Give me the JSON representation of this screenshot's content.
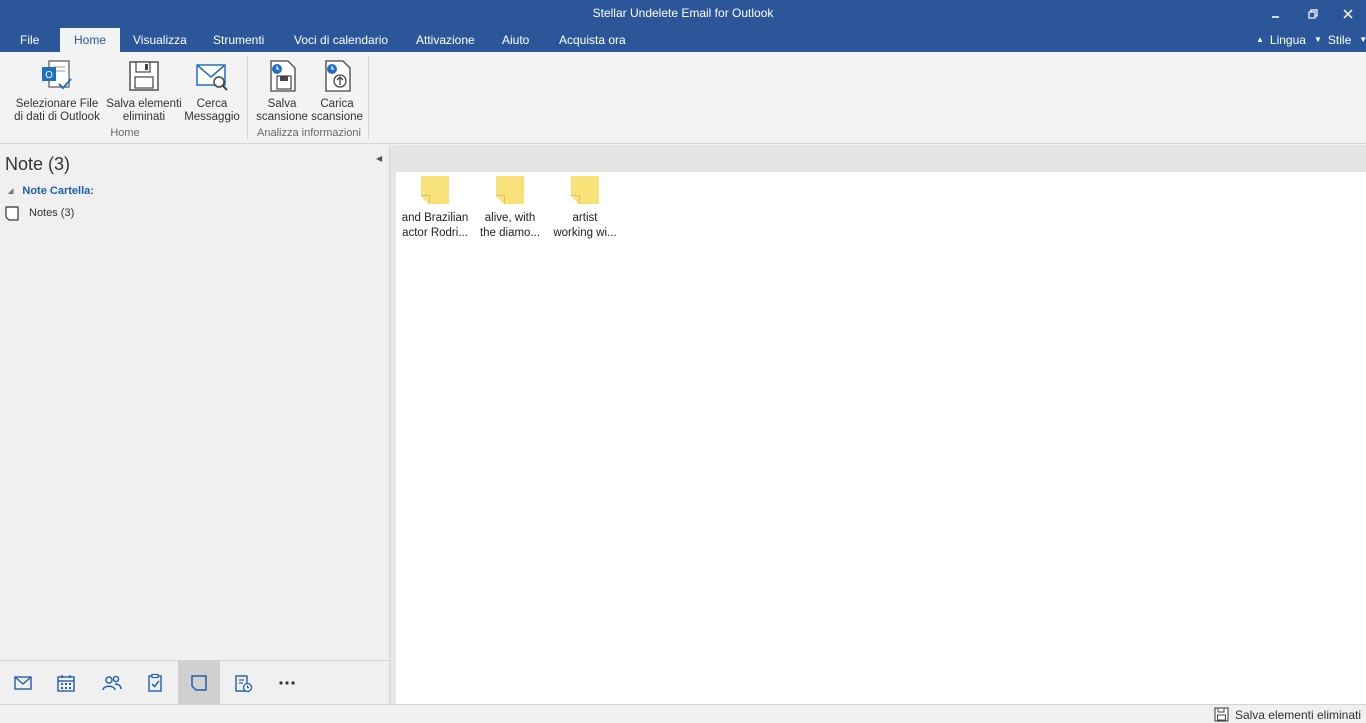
{
  "window": {
    "title": "Stellar Undelete Email for Outlook",
    "minimize_icon": "minimize-icon",
    "restore_icon": "restore-icon",
    "close_icon": "close-icon"
  },
  "menu": {
    "tabs": [
      "File",
      "Home",
      "Visualizza",
      "Strumenti",
      "Voci di calendario",
      "Attivazione",
      "Aiuto",
      "Acquista ora"
    ],
    "active_tab": "Home",
    "language": "Lingua",
    "style": "Stile"
  },
  "ribbon": {
    "groups": [
      {
        "label": "Home",
        "buttons": [
          {
            "line1": "Selezionare File",
            "line2": "di dati di Outlook",
            "icon": "outlook-file-icon"
          },
          {
            "line1": "Salva elementi",
            "line2": "eliminati",
            "icon": "floppy-save-icon"
          },
          {
            "line1": "Cerca",
            "line2": "Messaggio",
            "icon": "mail-search-icon"
          }
        ]
      },
      {
        "label": "Analizza informazioni",
        "buttons": [
          {
            "line1": "Salva",
            "line2": "scansione",
            "icon": "save-scan-icon"
          },
          {
            "line1": "Carica",
            "line2": "scansione",
            "icon": "load-scan-icon"
          }
        ]
      }
    ]
  },
  "left_panel": {
    "title": "Note (3)",
    "tree_header": "Note Cartella:",
    "tree_items": [
      {
        "label": "Notes (3)",
        "icon": "note-icon"
      }
    ],
    "bottom_nav": [
      {
        "icon": "mail-icon",
        "active": false
      },
      {
        "icon": "calendar-icon",
        "active": false
      },
      {
        "icon": "contacts-icon",
        "active": false
      },
      {
        "icon": "tasks-icon",
        "active": false
      },
      {
        "icon": "notes-icon",
        "active": true
      },
      {
        "icon": "journal-icon",
        "active": false
      },
      {
        "icon": "more-icon",
        "active": false
      }
    ]
  },
  "notes": [
    {
      "line1": "and Brazilian",
      "line2": "actor Rodri..."
    },
    {
      "line1": "alive, with",
      "line2": "the diamo..."
    },
    {
      "line1": "artist",
      "line2": "working wi..."
    }
  ],
  "colors": {
    "brand": "#2b579a",
    "sticky_note": "#fae27a",
    "tree_header": "#1f5fad"
  },
  "status": {
    "save_label": "Salva elementi eliminati"
  }
}
